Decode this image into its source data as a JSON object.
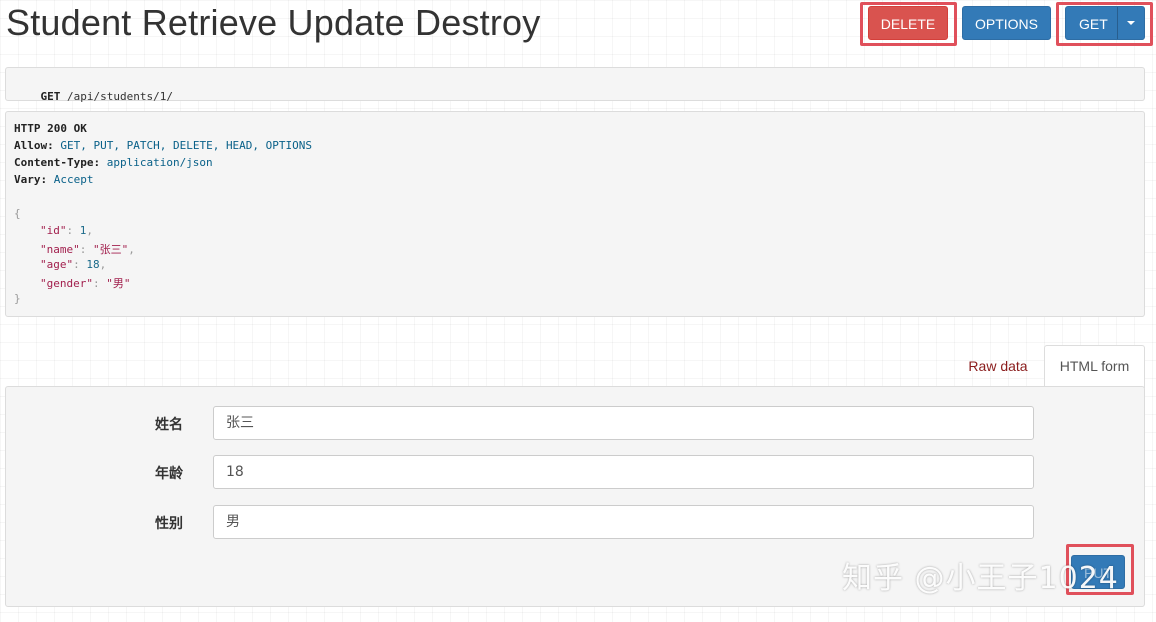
{
  "page": {
    "title": "Student Retrieve Update Destroy"
  },
  "toolbar": {
    "delete_label": "DELETE",
    "options_label": "OPTIONS",
    "get_label": "GET"
  },
  "request": {
    "method": "GET",
    "path": "/api/students/1/"
  },
  "response": {
    "status_line": "HTTP 200 OK",
    "headers": [
      {
        "name": "Allow:",
        "value": "GET, PUT, PATCH, DELETE, HEAD, OPTIONS"
      },
      {
        "name": "Content-Type:",
        "value": "application/json"
      },
      {
        "name": "Vary:",
        "value": "Accept"
      }
    ],
    "json_open": "{",
    "json_close": "}",
    "body": [
      {
        "key": "\"id\"",
        "value": "1",
        "type": "number",
        "comma": ","
      },
      {
        "key": "\"name\"",
        "value": "\"张三\"",
        "type": "string",
        "comma": ","
      },
      {
        "key": "\"age\"",
        "value": "18",
        "type": "number",
        "comma": ","
      },
      {
        "key": "\"gender\"",
        "value": "\"男\"",
        "type": "string",
        "comma": ""
      }
    ]
  },
  "tabs": {
    "raw_label": "Raw data",
    "html_label": "HTML form"
  },
  "form": {
    "fields": [
      {
        "label": "姓名",
        "value": "张三"
      },
      {
        "label": "年龄",
        "value": "18"
      },
      {
        "label": "性别",
        "value": "男"
      }
    ],
    "submit_label": "PUT"
  },
  "watermark": {
    "text": "知乎 @小王子1024"
  },
  "colors": {
    "danger": "#d9534f",
    "primary": "#337ab7",
    "highlight": "#e0505b",
    "raw_tab": "#8a1c1c"
  },
  "icons": {
    "dropdown": "caret-down-icon"
  }
}
